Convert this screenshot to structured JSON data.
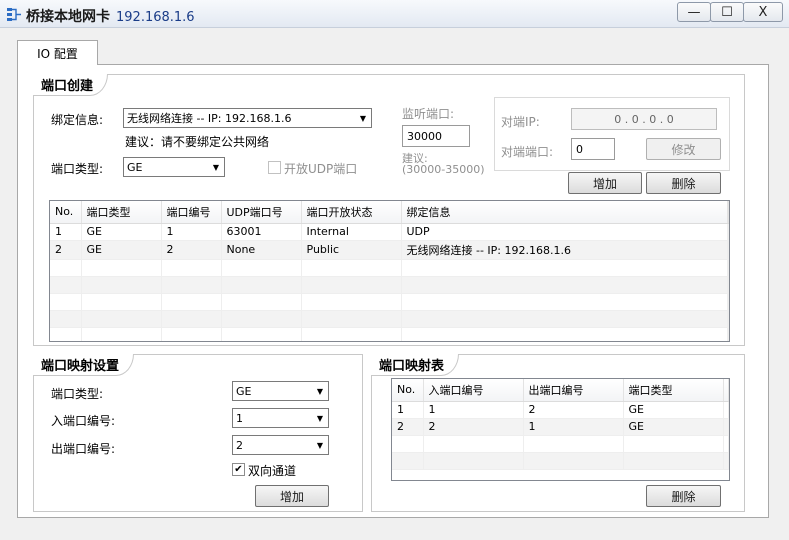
{
  "window": {
    "title": "桥接本地网卡",
    "ip": "192.168.1.6",
    "minimize": "—",
    "maximize": "☐",
    "close": "X"
  },
  "tab": {
    "label": "IO 配置"
  },
  "port_create": {
    "title": "端口创建",
    "bind_label": "绑定信息:",
    "bind_value": "无线网络连接 -- IP: 192.168.1.6",
    "suggestion": "建议：请不要绑定公共网络",
    "port_type_label": "端口类型:",
    "port_type_value": "GE",
    "udp_label": "开放UDP端口",
    "udp_checked": false,
    "listen_label": "监听端口:",
    "listen_value": "30000",
    "listen_hint": "建议:",
    "listen_range": "(30000-35000)",
    "remote_ip_label": "对端IP:",
    "remote_ip_value": "0  .  0  .  0  .  0",
    "remote_port_label": "对端端口:",
    "remote_port_value": "0",
    "modify_button": "修改",
    "add_button": "增加",
    "delete_button": "删除",
    "table": {
      "headers": [
        "No.",
        "端口类型",
        "端口编号",
        "UDP端口号",
        "端口开放状态",
        "绑定信息"
      ],
      "rows": [
        [
          "1",
          "GE",
          "1",
          "63001",
          "Internal",
          "UDP"
        ],
        [
          "2",
          "GE",
          "2",
          "None",
          "Public",
          "无线网络连接 -- IP: 192.168.1.6"
        ]
      ]
    }
  },
  "mapping_settings": {
    "title": "端口映射设置",
    "port_type_label": "端口类型:",
    "port_type_value": "GE",
    "in_port_label": "入端口编号:",
    "in_port_value": "1",
    "out_port_label": "出端口编号:",
    "out_port_value": "2",
    "bidirectional_label": "双向通道",
    "bidirectional_checked": true,
    "add_button": "增加"
  },
  "mapping_table": {
    "title": "端口映射表",
    "headers": [
      "No.",
      "入端口编号",
      "出端口编号",
      "端口类型"
    ],
    "rows": [
      [
        "1",
        "1",
        "2",
        "GE"
      ],
      [
        "2",
        "2",
        "1",
        "GE"
      ]
    ],
    "delete_button": "删除"
  }
}
